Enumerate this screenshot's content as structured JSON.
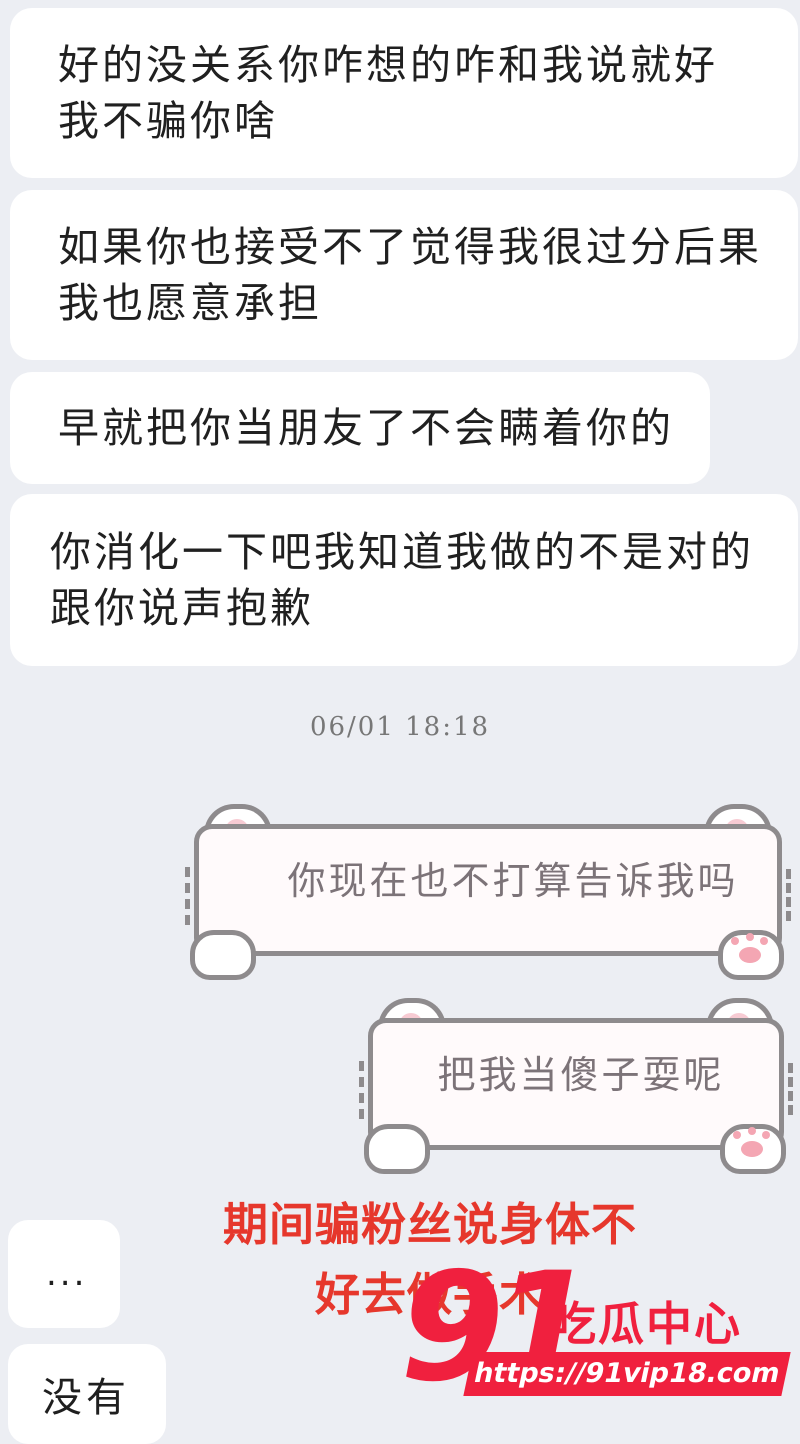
{
  "messages_received": [
    {
      "text": "好的没关系你咋想的咋和我说就好我不骗你啥"
    },
    {
      "text": "如果你也接受不了觉得我很过分后果我也愿意承担"
    },
    {
      "text": "早就把你当朋友了不会瞒着你的"
    },
    {
      "text": "你消化一下吧我知道我做的不是对的跟你说声抱歉"
    }
  ],
  "timestamp": "06/01 18:18",
  "messages_sent": [
    {
      "text": "你现在也不打算告诉我吗"
    },
    {
      "text": "把我当傻子耍呢"
    }
  ],
  "caption": {
    "line1": "期间骗粉丝说身体不",
    "line2": "好去做手术"
  },
  "later_received": [
    {
      "text": "..."
    },
    {
      "text": "没有"
    }
  ],
  "watermark": {
    "number": "91",
    "name": "吃瓜中心",
    "url": "https://91vip18.com"
  },
  "colors": {
    "background": "#eceef3",
    "caption_red": "#e6372c",
    "watermark_red": "#f0203e",
    "cat_outline": "#8e8b8d"
  }
}
